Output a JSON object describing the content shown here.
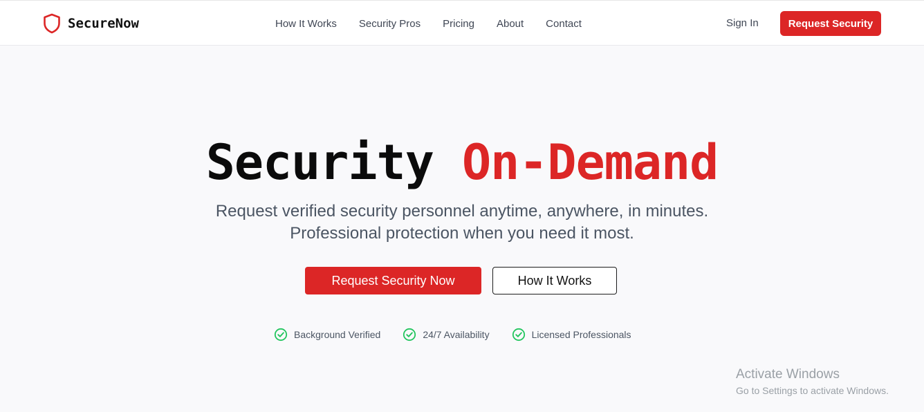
{
  "header": {
    "brand_name": "SecureNow",
    "brand_icon": "shield-icon",
    "nav_links": [
      "How It Works",
      "Security Pros",
      "Pricing",
      "About",
      "Contact"
    ],
    "sign_in": "Sign In",
    "cta": "Request Security"
  },
  "hero": {
    "title_part1": "Security",
    "title_part2": "On-Demand",
    "subtitle_line1": "Request verified security personnel anytime, anywhere, in minutes.",
    "subtitle_line2": "Professional protection when you need it most.",
    "primary_button": "Request Security Now",
    "secondary_button": "How It Works",
    "features": [
      {
        "label": "Background Verified",
        "icon": "check-circle-icon"
      },
      {
        "label": "24/7 Availability",
        "icon": "check-circle-icon"
      },
      {
        "label": "Licensed Professionals",
        "icon": "check-circle-icon"
      }
    ]
  },
  "watermark": {
    "title": "Activate Windows",
    "subtitle": "Go to Settings to activate Windows."
  },
  "colors": {
    "accent": "#dc2626",
    "check": "#22c55e",
    "background": "#f9f9fb"
  }
}
